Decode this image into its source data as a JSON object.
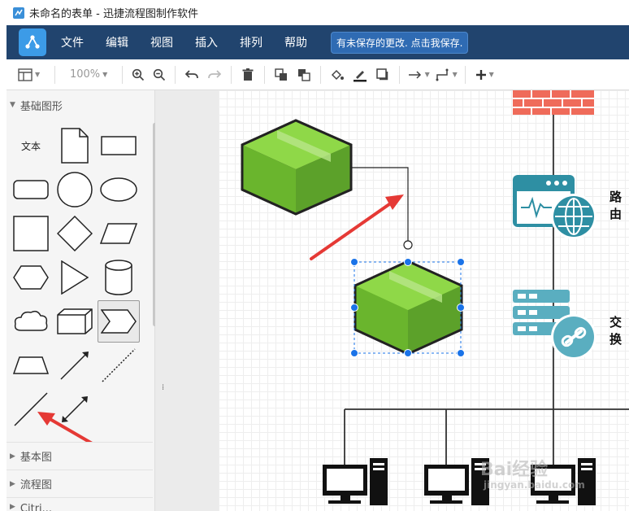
{
  "window": {
    "title": "未命名的表单 - 迅捷流程图制作软件"
  },
  "menu": {
    "items": [
      "文件",
      "编辑",
      "视图",
      "插入",
      "排列",
      "帮助"
    ],
    "save_notice": "有未保存的更改. 点击我保存."
  },
  "toolbar": {
    "zoom": "100%"
  },
  "sidebar": {
    "section_title": "基础图形",
    "text_shape_label": "文本",
    "collapsed_sections": [
      "基本图",
      "流程图",
      "Citri..."
    ]
  },
  "canvas": {
    "labels": [
      "路由",
      "交换"
    ]
  },
  "watermark": {
    "line1": "Bai经验",
    "line2": "jingyan.baidu.com"
  },
  "colors": {
    "menubar": "#21446e",
    "accent": "#3c9be7",
    "box_green": "#7dc63a",
    "firewall": "#ef6b5a",
    "teal_icon": "#2e8fa3",
    "arrow_red": "#e53935",
    "selection": "#1a73e8"
  }
}
